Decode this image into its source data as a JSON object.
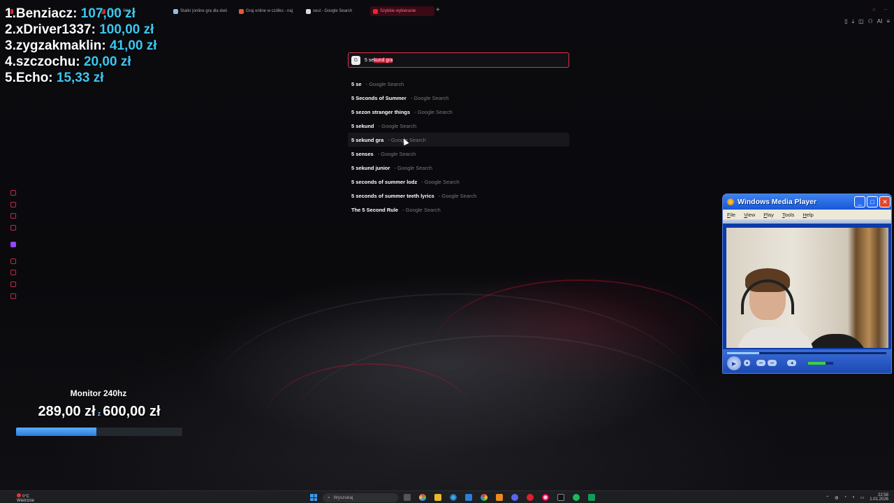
{
  "browser": {
    "tabs": [
      {
        "label": "",
        "active": false,
        "color": "#c33"
      },
      {
        "label": "...eam - Wat",
        "active": false,
        "color": "#c33"
      },
      {
        "label": "Statki (online gra dla dwó",
        "active": false,
        "color": "#9bd"
      },
      {
        "label": "Graj online w czółko - naj",
        "active": false,
        "color": "#e53"
      },
      {
        "label": "seul - Google Search",
        "active": false,
        "color": "#ddd"
      },
      {
        "label": "Szybkie wybieranie",
        "active": true,
        "color": "#e23"
      }
    ],
    "new_tab_label": "+",
    "toolbar_icons": [
      "bookmark-icon",
      "download-icon",
      "camera-icon",
      "menu-icon"
    ],
    "aria_label": "AI"
  },
  "donors": [
    {
      "rank": "1.",
      "name": "Benziacz:",
      "amount": "107,00 zł"
    },
    {
      "rank": "2.",
      "name": "xDriver1337:",
      "amount": "100,00 zł"
    },
    {
      "rank": "3.",
      "name": "zygzakmaklin:",
      "amount": "41,00 zł"
    },
    {
      "rank": "4.",
      "name": "szczochu:",
      "amount": "20,00 zł"
    },
    {
      "rank": "5.",
      "name": "Echo:",
      "amount": "15,33 zł"
    }
  ],
  "search": {
    "engine_badge": "G",
    "typed": "5 se",
    "completion": "kund gra",
    "suggestions": [
      {
        "query": "5 se",
        "source": "Google Search",
        "highlighted": false
      },
      {
        "query": "5 Seconds of Summer",
        "source": "Google Search",
        "highlighted": false
      },
      {
        "query": "5 sezon stranger things",
        "source": "Google Search",
        "highlighted": false
      },
      {
        "query": "5 sekund",
        "source": "Google Search",
        "highlighted": false
      },
      {
        "query": "5 sekund gra",
        "source": "Google Search",
        "highlighted": true
      },
      {
        "query": "5 senses",
        "source": "Google Search",
        "highlighted": false
      },
      {
        "query": "5 sekund junior",
        "source": "Google Search",
        "highlighted": false
      },
      {
        "query": "5 seconds of summer lodz",
        "source": "Google Search",
        "highlighted": false
      },
      {
        "query": "5 seconds of summer teeth lyrics",
        "source": "Google Search",
        "highlighted": false
      },
      {
        "query": "The 5 Second Rule",
        "source": "Google Search",
        "highlighted": false
      }
    ]
  },
  "sidebar_icons": [
    "history-icon",
    "shop-icon",
    "wallet-icon",
    "news-icon",
    "twitch-icon",
    "clock-icon",
    "history-icon",
    "send-icon",
    "settings-icon"
  ],
  "media_player": {
    "title": "Windows Media Player",
    "menu": [
      "File",
      "View",
      "Play",
      "Tools",
      "Help"
    ],
    "seek_fraction": 0.2,
    "volume_fraction": 0.7
  },
  "goal": {
    "title": "Monitor 240hz",
    "current": "289,00 zł",
    "separator": "z",
    "target": "600,00 zł",
    "progress_fraction": 0.4817
  },
  "taskbar": {
    "weather_temp": "0°C",
    "weather_desc": "Wietrznie",
    "search_placeholder": "Wyszukaj",
    "time": "22:58",
    "date": "1.01.2026"
  }
}
